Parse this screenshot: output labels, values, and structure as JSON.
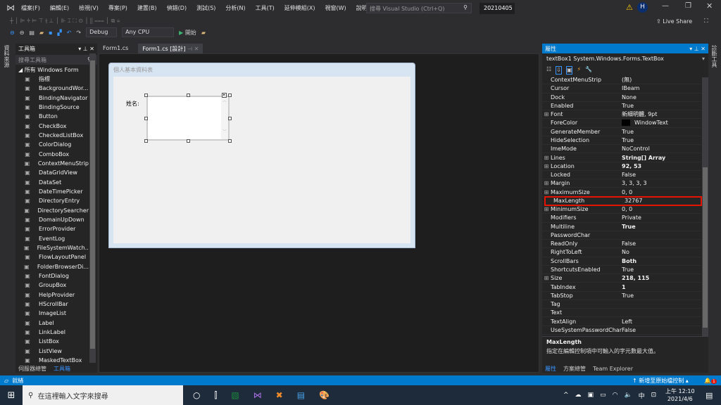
{
  "menu": {
    "items": [
      "檔案(F)",
      "編輯(E)",
      "檢視(V)",
      "專案(P)",
      "建置(B)",
      "偵錯(D)",
      "測試(S)",
      "分析(N)",
      "工具(T)",
      "延伸模組(X)",
      "視窗(W)",
      "說明(H)"
    ],
    "search_placeholder": "搜尋 Visual Studio (Ctrl+Q)",
    "project_name": "20210405",
    "avatar_letter": "H",
    "live_share": "Live Share"
  },
  "toolbar": {
    "config": "Debug",
    "platform": "Any CPU",
    "start": "開始"
  },
  "left_strip": {
    "label": "資料來源"
  },
  "right_strip": {
    "label": "診斷工具"
  },
  "toolbox": {
    "title": "工具箱",
    "search_placeholder": "搜尋工具箱",
    "group": "所有 Windows Form",
    "items": [
      [
        "pointer-icon",
        "指標"
      ],
      [
        "background-worker-icon",
        "BackgroundWor..."
      ],
      [
        "binding-navigator-icon",
        "BindingNavigator"
      ],
      [
        "binding-source-icon",
        "BindingSource"
      ],
      [
        "button-icon",
        "Button"
      ],
      [
        "checkbox-icon",
        "CheckBox"
      ],
      [
        "checked-listbox-icon",
        "CheckedListBox"
      ],
      [
        "color-dialog-icon",
        "ColorDialog"
      ],
      [
        "combobox-icon",
        "ComboBox"
      ],
      [
        "context-menu-icon",
        "ContextMenuStrip"
      ],
      [
        "datagridview-icon",
        "DataGridView"
      ],
      [
        "dataset-icon",
        "DataSet"
      ],
      [
        "datetimepicker-icon",
        "DateTimePicker"
      ],
      [
        "directory-entry-icon",
        "DirectoryEntry"
      ],
      [
        "directory-searcher-icon",
        "DirectorySearcher"
      ],
      [
        "domain-updown-icon",
        "DomainUpDown"
      ],
      [
        "error-provider-icon",
        "ErrorProvider"
      ],
      [
        "eventlog-icon",
        "EventLog"
      ],
      [
        "filesystem-watcher-icon",
        "FileSystemWatch..."
      ],
      [
        "flow-layout-icon",
        "FlowLayoutPanel"
      ],
      [
        "folder-browser-icon",
        "FolderBrowserDi..."
      ],
      [
        "font-dialog-icon",
        "FontDialog"
      ],
      [
        "groupbox-icon",
        "GroupBox"
      ],
      [
        "help-provider-icon",
        "HelpProvider"
      ],
      [
        "hscrollbar-icon",
        "HScrollBar"
      ],
      [
        "imagelist-icon",
        "ImageList"
      ],
      [
        "label-icon",
        "Label"
      ],
      [
        "linklabel-icon",
        "LinkLabel"
      ],
      [
        "listbox-icon",
        "ListBox"
      ],
      [
        "listview-icon",
        "ListView"
      ],
      [
        "masked-textbox-icon",
        "MaskedTextBox"
      ]
    ],
    "tabs": [
      "伺服器總管",
      "工具箱"
    ]
  },
  "editor": {
    "tabs": [
      "Form1.cs",
      "Form1.cs [設計]"
    ],
    "form_title": "個人基本資料表",
    "label_name": "姓名:"
  },
  "properties": {
    "title": "屬性",
    "object": "textBox1  System.Windows.Forms.TextBox",
    "rows": [
      {
        "n": "ContextMenuStrip",
        "v": "(無)"
      },
      {
        "n": "Cursor",
        "v": "IBeam"
      },
      {
        "n": "Dock",
        "v": "None"
      },
      {
        "n": "Enabled",
        "v": "True"
      },
      {
        "n": "Font",
        "v": "新細明體, 9pt",
        "x": 1
      },
      {
        "n": "ForeColor",
        "v": "WindowText",
        "swatch": "#000000"
      },
      {
        "n": "GenerateMember",
        "v": "True"
      },
      {
        "n": "HideSelection",
        "v": "True"
      },
      {
        "n": "ImeMode",
        "v": "NoControl"
      },
      {
        "n": "Lines",
        "v": "String[] Array",
        "x": 1,
        "b": 1
      },
      {
        "n": "Location",
        "v": "92, 53",
        "x": 1,
        "b": 1
      },
      {
        "n": "Locked",
        "v": "False"
      },
      {
        "n": "Margin",
        "v": "3, 3, 3, 3",
        "x": 1
      },
      {
        "n": "MaximumSize",
        "v": "0, 0",
        "x": 1
      },
      {
        "n": "MaxLength",
        "v": "32767",
        "hl": 1
      },
      {
        "n": "MinimumSize",
        "v": "0, 0",
        "x": 1
      },
      {
        "n": "Modifiers",
        "v": "Private"
      },
      {
        "n": "Multiline",
        "v": "True",
        "b": 1
      },
      {
        "n": "PasswordChar",
        "v": ""
      },
      {
        "n": "ReadOnly",
        "v": "False"
      },
      {
        "n": "RightToLeft",
        "v": "No"
      },
      {
        "n": "ScrollBars",
        "v": "Both",
        "b": 1
      },
      {
        "n": "ShortcutsEnabled",
        "v": "True"
      },
      {
        "n": "Size",
        "v": "218, 115",
        "x": 1,
        "b": 1
      },
      {
        "n": "TabIndex",
        "v": "1",
        "b": 1
      },
      {
        "n": "TabStop",
        "v": "True"
      },
      {
        "n": "Tag",
        "v": ""
      },
      {
        "n": "Text",
        "v": ""
      },
      {
        "n": "TextAlign",
        "v": "Left"
      },
      {
        "n": "UseSystemPasswordChar",
        "v": "False"
      }
    ],
    "desc_title": "MaxLength",
    "desc_text": "指定在編輯控制項中可輸入的字元數最大值。",
    "tabs": [
      "屬性",
      "方案總管",
      "Team Explorer"
    ]
  },
  "status": {
    "text": "就緒",
    "source_control": "新增至原始檔控制",
    "notifications": "1"
  },
  "taskbar": {
    "search_placeholder": "在這裡輸入文字來搜尋",
    "time": "上午 12:10",
    "date": "2021/4/6",
    "ime": "中"
  },
  "colors": {
    "accent": "#007acc",
    "highlight": "#e51400"
  }
}
